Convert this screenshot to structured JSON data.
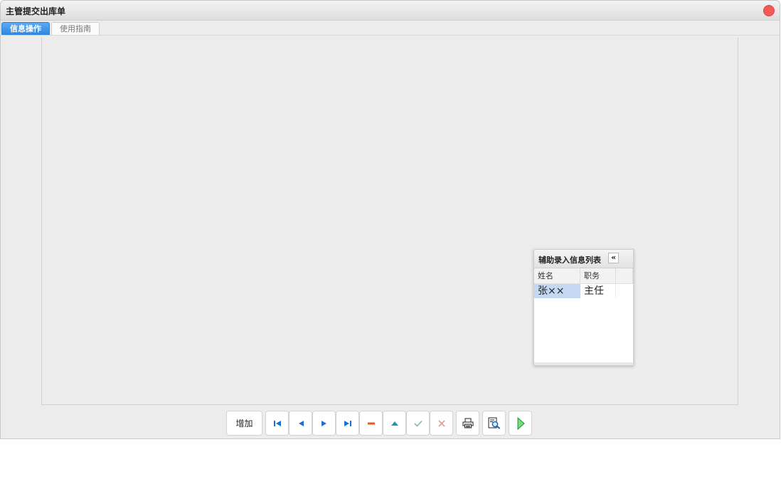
{
  "window": {
    "title": "主管提交出库单"
  },
  "tabs": [
    {
      "label": "信息操作",
      "active": true
    },
    {
      "label": "使用指南",
      "active": false
    }
  ],
  "helper_panel": {
    "title": "辅助录入信息列表",
    "collapse_glyph": "«",
    "columns": [
      "姓名",
      "职务"
    ],
    "rows": [
      {
        "name": "张××",
        "position": "主任",
        "selected": true
      }
    ]
  },
  "toolbar": {
    "add_label": "增加",
    "icons": [
      "first-record-icon",
      "previous-record-icon",
      "next-record-icon",
      "last-record-icon",
      "delete-icon",
      "move-up-icon",
      "confirm-icon",
      "cancel-icon",
      "print-icon",
      "print-preview-icon",
      "submit-icon"
    ]
  },
  "colors": {
    "accent": "#2f86e0",
    "close": "#f45a55",
    "selection": "#c5d8f3"
  }
}
